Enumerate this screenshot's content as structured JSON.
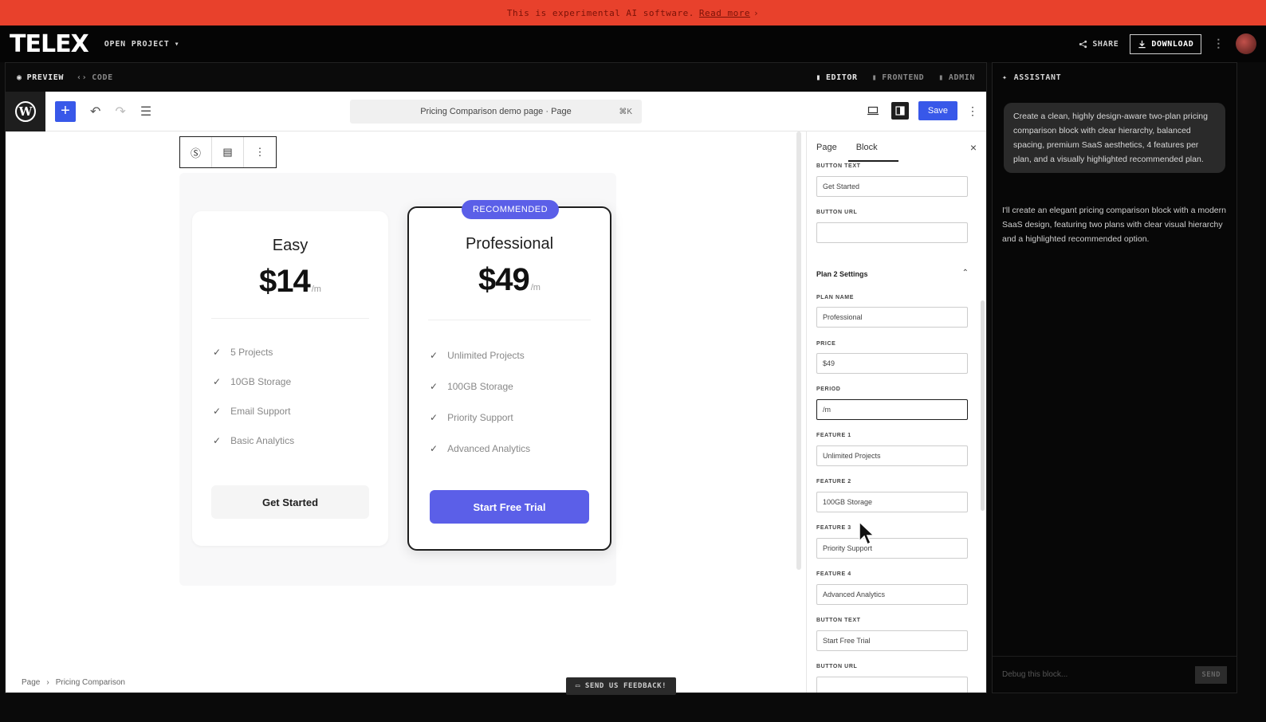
{
  "banner": {
    "text": "This is experimental AI software.",
    "link": "Read more"
  },
  "header": {
    "logo": "TELEX",
    "open_project": "OPEN PROJECT",
    "share": "SHARE",
    "download": "DOWNLOAD"
  },
  "editor_tabs": {
    "preview": "PREVIEW",
    "code": "CODE",
    "editor": "EDITOR",
    "frontend": "FRONTEND",
    "admin": "ADMIN"
  },
  "wp": {
    "doc_title": "Pricing Comparison demo page · Page",
    "shortcut": "⌘K",
    "save": "Save"
  },
  "plans": [
    {
      "name": "Easy",
      "price": "$14",
      "period": "/m",
      "features": [
        "5 Projects",
        "10GB Storage",
        "Email Support",
        "Basic Analytics"
      ],
      "button": "Get Started"
    },
    {
      "name": "Professional",
      "price": "$49",
      "period": "/m",
      "badge": "RECOMMENDED",
      "features": [
        "Unlimited Projects",
        "100GB Storage",
        "Priority Support",
        "Advanced Analytics"
      ],
      "button": "Start Free Trial"
    }
  ],
  "breadcrumb": {
    "root": "Page",
    "sep": "›",
    "current": "Pricing Comparison"
  },
  "inspector": {
    "tab_page": "Page",
    "tab_block": "Block",
    "close": "×",
    "plan1_button_text_label": "BUTTON TEXT",
    "plan1_button_text_value": "Get Started",
    "plan1_button_url_label": "BUTTON URL",
    "plan1_button_url_value": "",
    "section_plan2": "Plan 2 Settings",
    "plan_name_label": "PLAN NAME",
    "plan_name_value": "Professional",
    "price_label": "PRICE",
    "price_value": "$49",
    "period_label": "PERIOD",
    "period_value": "/m",
    "feature1_label": "FEATURE 1",
    "feature1_value": "Unlimited Projects",
    "feature2_label": "FEATURE 2",
    "feature2_value": "100GB Storage",
    "feature3_label": "FEATURE 3",
    "feature3_value": "Priority Support",
    "feature4_label": "FEATURE 4",
    "feature4_value": "Advanced Analytics",
    "button_text_label": "BUTTON TEXT",
    "button_text_value": "Start Free Trial",
    "button_url_label": "BUTTON URL"
  },
  "feedback": "SEND US FEEDBACK!",
  "assistant": {
    "title": "ASSISTANT",
    "user_message": "Create a clean, highly design-aware two-plan pricing comparison block with clear hierarchy, balanced spacing, premium SaaS aesthetics, 4 features per plan, and a visually highlighted recommended plan.",
    "assistant_message": "I'll create an elegant pricing comparison block with a modern SaaS design, featuring two plans with clear visual hierarchy and a highlighted recommended option.",
    "input_placeholder": "Debug this block...",
    "send": "SEND"
  },
  "colors": {
    "banner": "#e8412c",
    "wp_blue": "#3858e9",
    "accent": "#5b5fe8"
  }
}
